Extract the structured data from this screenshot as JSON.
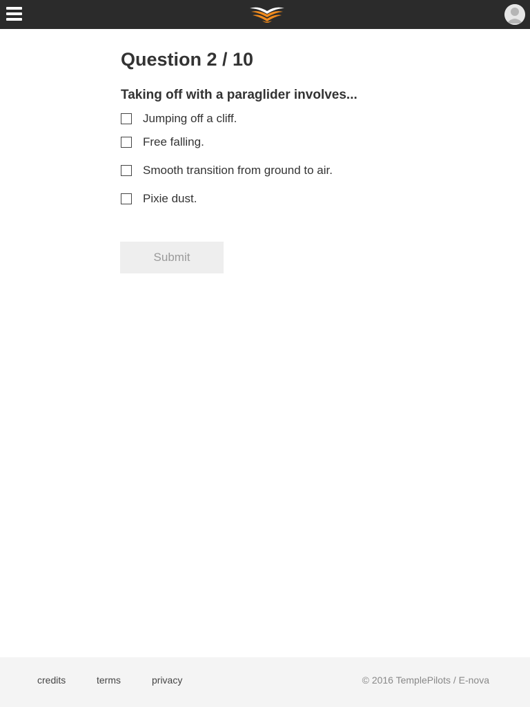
{
  "header": {
    "menu_icon": "hamburger-menu-icon",
    "logo_icon": "wings-logo-icon",
    "avatar_icon": "user-avatar-icon",
    "colors": {
      "bar": "#2b2b2b",
      "logo_orange": "#f08a1c"
    }
  },
  "quiz": {
    "title": "Question 2 / 10",
    "prompt": "Taking off with a paraglider involves...",
    "options": [
      {
        "label": "Jumping off a cliff.",
        "checked": false
      },
      {
        "label": "Free falling.",
        "checked": false
      },
      {
        "label": "Smooth transition from ground to air.",
        "checked": false
      },
      {
        "label": "Pixie dust.",
        "checked": false
      }
    ],
    "submit_label": "Submit"
  },
  "footer": {
    "links": [
      "credits",
      "terms",
      "privacy"
    ],
    "copyright": "© 2016 TemplePilots / E-nova"
  }
}
